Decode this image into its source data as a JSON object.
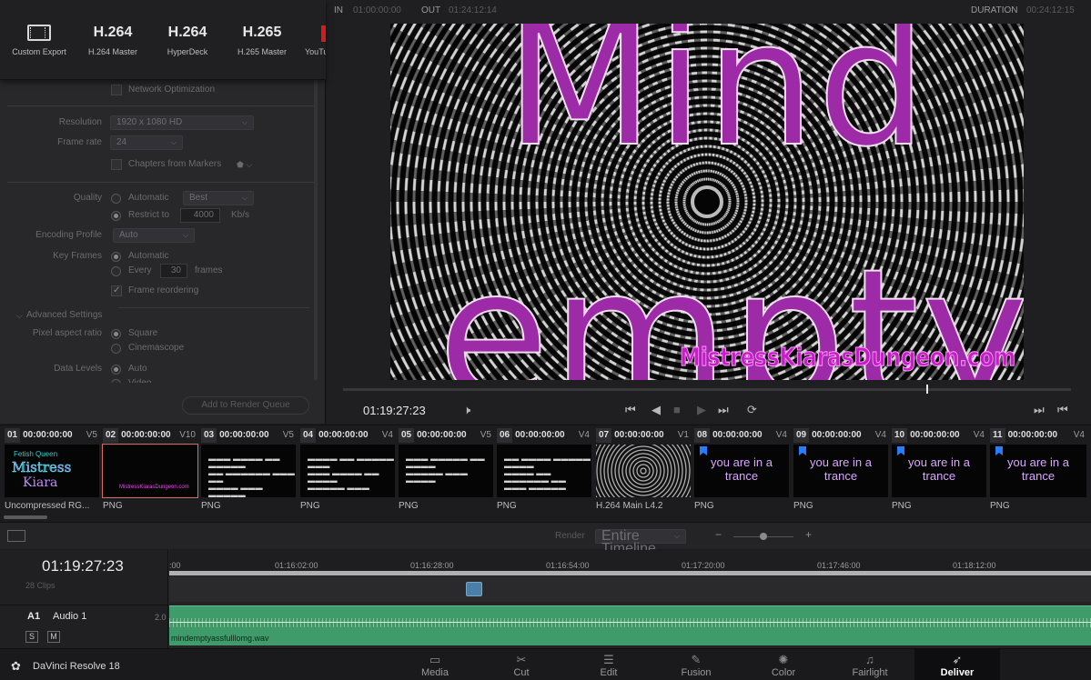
{
  "presets": [
    {
      "label": "Custom Export",
      "big": ""
    },
    {
      "label": "H.264 Master",
      "big": "H.264"
    },
    {
      "label": "HyperDeck",
      "big": "H.264"
    },
    {
      "label": "H.265 Master",
      "big": "H.265"
    },
    {
      "label": "YouTu",
      "big": ""
    }
  ],
  "settings": {
    "network_optimization": "Network Optimization",
    "resolution_label": "Resolution",
    "resolution_value": "1920 x 1080 HD",
    "frame_rate_label": "Frame rate",
    "frame_rate_value": "24",
    "chapters_label": "Chapters from Markers",
    "quality_label": "Quality",
    "quality_automatic": "Automatic",
    "quality_best": "Best",
    "restrict_to": "Restrict to",
    "restrict_value": "4000",
    "restrict_unit": "Kb/s",
    "encoding_profile_label": "Encoding Profile",
    "encoding_profile_value": "Auto",
    "key_frames_label": "Key Frames",
    "key_frames_automatic": "Automatic",
    "key_frames_every": "Every",
    "key_frames_value": "30",
    "key_frames_unit": "frames",
    "frame_reordering": "Frame reordering",
    "advanced_settings": "Advanced Settings",
    "pixel_aspect_label": "Pixel aspect ratio",
    "pixel_square": "Square",
    "pixel_cinemascope": "Cinemascope",
    "data_levels_label": "Data Levels",
    "data_levels_auto": "Auto",
    "data_levels_video": "Video",
    "add_to_queue": "Add to Render Queue"
  },
  "viewer": {
    "in_label": "IN",
    "in_value": "01:00:00:00",
    "out_label": "OUT",
    "out_value": "01:24:12:14",
    "duration_label": "DURATION",
    "duration_value": "00:24:12:15",
    "word1": "Mind",
    "word2": "empty",
    "watermark": "MistressKiarasDungeon.com",
    "timecode": "01:19:27:23"
  },
  "clips": [
    {
      "num": "01",
      "time": "00:00:00:00",
      "track": "V5",
      "format": "Uncompressed RG...",
      "kind": "logo",
      "logo_small": "Fetish Queen",
      "logo_main": "Mistress",
      "logo_sub": "Kiara"
    },
    {
      "num": "02",
      "time": "00:00:00:00",
      "track": "V10",
      "format": "PNG",
      "kind": "black",
      "text": "MistressKiarasDungeon.com"
    },
    {
      "num": "03",
      "time": "00:00:00:00",
      "track": "V5",
      "format": "PNG",
      "kind": "text"
    },
    {
      "num": "04",
      "time": "00:00:00:00",
      "track": "V4",
      "format": "PNG",
      "kind": "text"
    },
    {
      "num": "05",
      "time": "00:00:00:00",
      "track": "V5",
      "format": "PNG",
      "kind": "text"
    },
    {
      "num": "06",
      "time": "00:00:00:00",
      "track": "V4",
      "format": "PNG",
      "kind": "text"
    },
    {
      "num": "07",
      "time": "00:00:00:00",
      "track": "V1",
      "format": "H.264 Main L4.2",
      "kind": "rings"
    },
    {
      "num": "08",
      "time": "00:00:00:00",
      "track": "V4",
      "format": "PNG",
      "kind": "trance",
      "text": "you are in a trance"
    },
    {
      "num": "09",
      "time": "00:00:00:00",
      "track": "V4",
      "format": "PNG",
      "kind": "trance",
      "text": "you are in a trance"
    },
    {
      "num": "10",
      "time": "00:00:00:00",
      "track": "V4",
      "format": "PNG",
      "kind": "trance",
      "text": "you are in a trance"
    },
    {
      "num": "11",
      "time": "00:00:00:00",
      "track": "V4",
      "format": "PNG",
      "kind": "trance",
      "text": "you are in a trance"
    }
  ],
  "render": {
    "label": "Render",
    "value": "Entire Timeline"
  },
  "timeline": {
    "timecode": "01:19:27:23",
    "clips_count": "28 Clips",
    "ticks": [
      ":00",
      "01:16:02:00",
      "01:16:28:00",
      "01:16:54:00",
      "01:17:20:00",
      "01:17:46:00",
      "01:18:12:00"
    ],
    "audio_track": "A1",
    "audio_name": "Audio 1",
    "audio_channels": "2.0",
    "solo": "S",
    "mute": "M",
    "audio_clip": "mindemptyassfulllomg.wav"
  },
  "app": {
    "name": "DaVinci Resolve 18"
  },
  "pages": [
    {
      "label": "Media",
      "icon": "▭"
    },
    {
      "label": "Cut",
      "icon": "✂"
    },
    {
      "label": "Edit",
      "icon": "☰"
    },
    {
      "label": "Fusion",
      "icon": "✎"
    },
    {
      "label": "Color",
      "icon": "✺"
    },
    {
      "label": "Fairlight",
      "icon": "♫"
    },
    {
      "label": "Deliver",
      "icon": "➶",
      "active": true
    }
  ]
}
